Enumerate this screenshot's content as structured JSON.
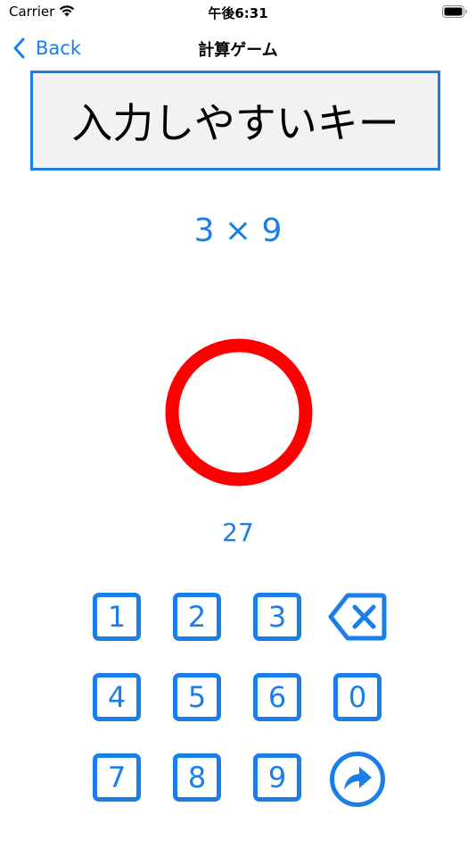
{
  "status_bar": {
    "carrier": "Carrier",
    "time": "午後6:31"
  },
  "nav": {
    "back_label": "Back",
    "title": "計算ゲーム"
  },
  "banner": {
    "text": "入力しやすいキー"
  },
  "question": "3 × 9",
  "result": "correct-circle",
  "answer": "27",
  "keypad": {
    "keys": [
      "1",
      "2",
      "3",
      "4",
      "5",
      "6",
      "0",
      "7",
      "8",
      "9"
    ],
    "backspace_icon": "backspace-icon",
    "submit_icon": "submit-arrow-icon"
  },
  "colors": {
    "accent": "#1a7ee8",
    "correct": "#ff0000",
    "banner_bg": "#f2f2f2"
  }
}
